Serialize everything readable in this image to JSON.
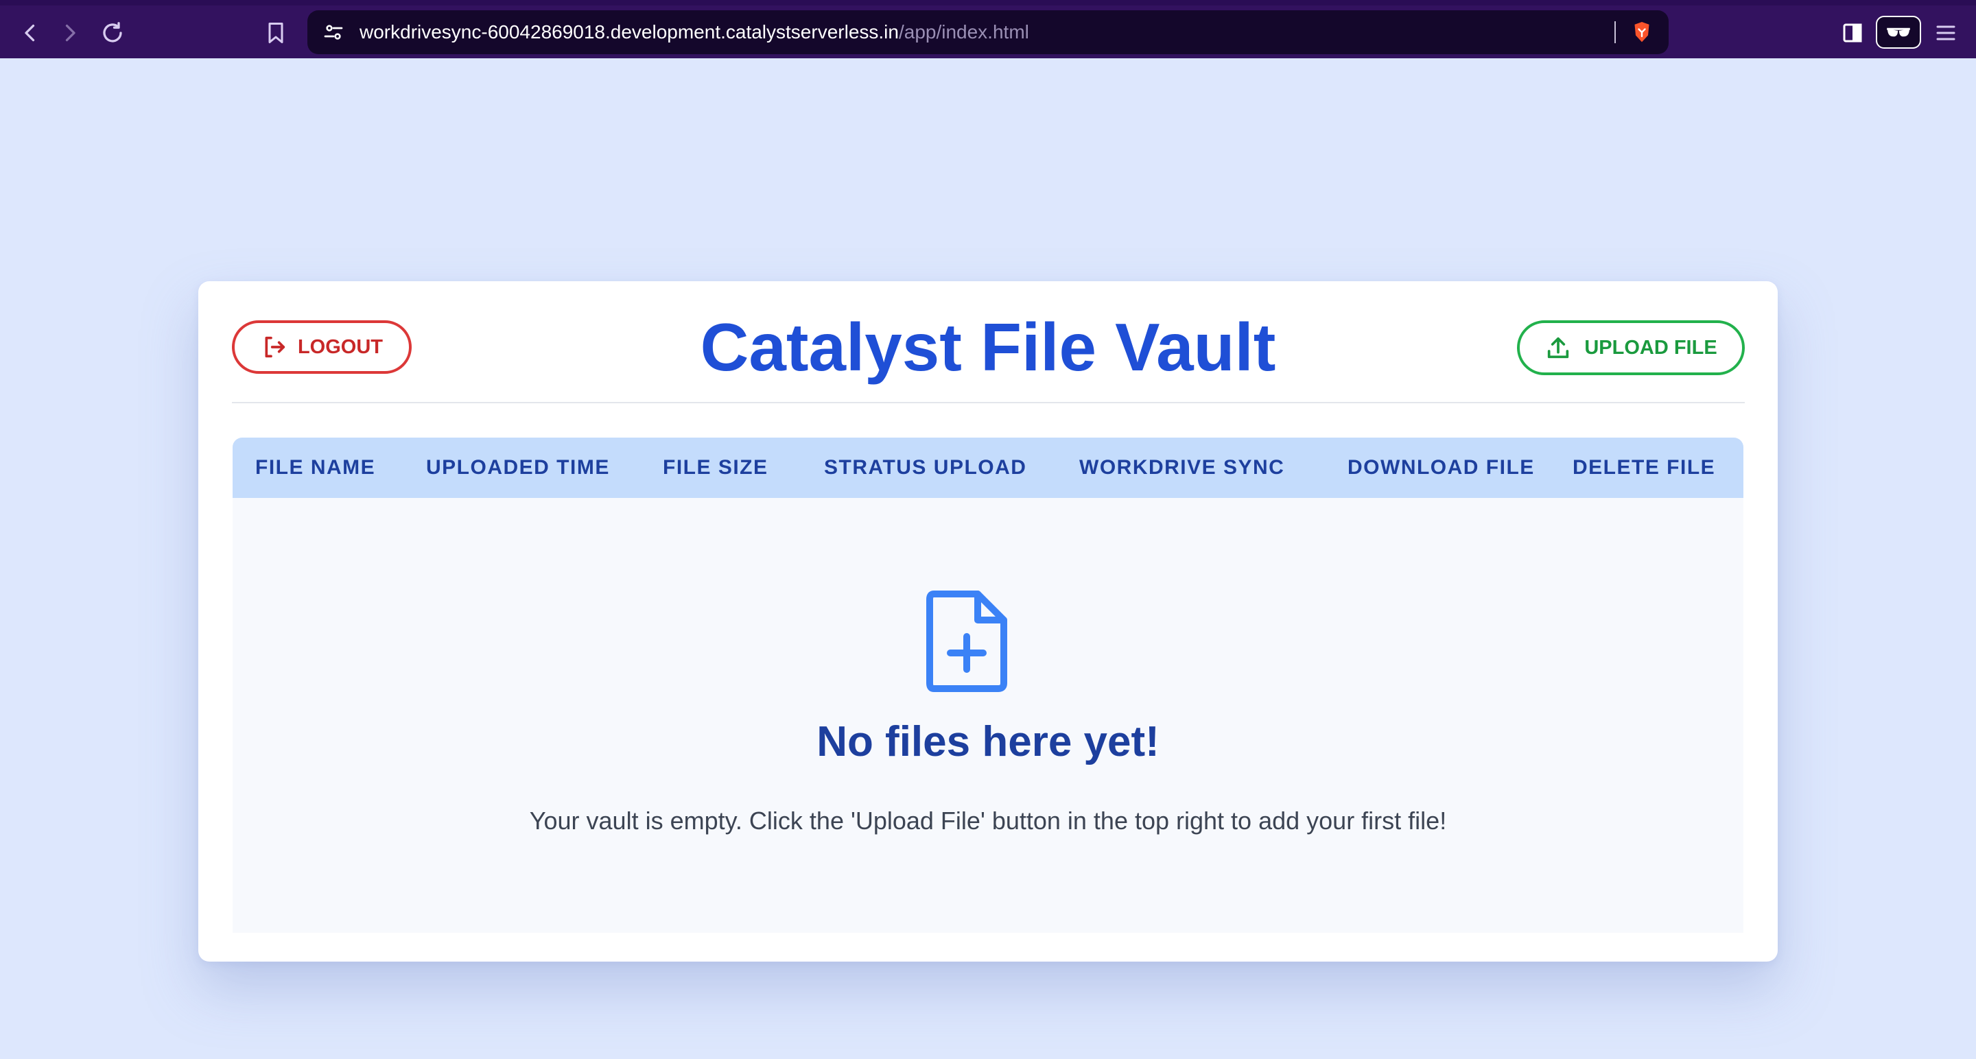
{
  "browser": {
    "url_main": "workdrivesync-60042869018.development.catalystserverless.in",
    "url_path": "/app/index.html",
    "icons": [
      "back-icon",
      "forward-icon",
      "reload-icon",
      "bookmark-icon",
      "site-settings-icon",
      "brave-shield-icon",
      "sidebar-icon",
      "reader-mode-icon",
      "menu-icon"
    ]
  },
  "app": {
    "title": "Catalyst File Vault",
    "logout_label": "LOGOUT",
    "upload_label": "UPLOAD FILE",
    "accent_blue": "#1f4fd6",
    "logout_color": "#dc3838",
    "upload_color": "#22b14c"
  },
  "table": {
    "columns": [
      "FILE NAME",
      "UPLOADED TIME",
      "FILE SIZE",
      "STRATUS UPLOAD",
      "WORKDRIVE SYNC",
      "DOWNLOAD FILE",
      "DELETE FILE"
    ],
    "rows": []
  },
  "empty_state": {
    "icon": "file-plus-icon",
    "title": "No files here yet!",
    "message": "Your vault is empty. Click the 'Upload File' button in the top right to add your first file!"
  }
}
